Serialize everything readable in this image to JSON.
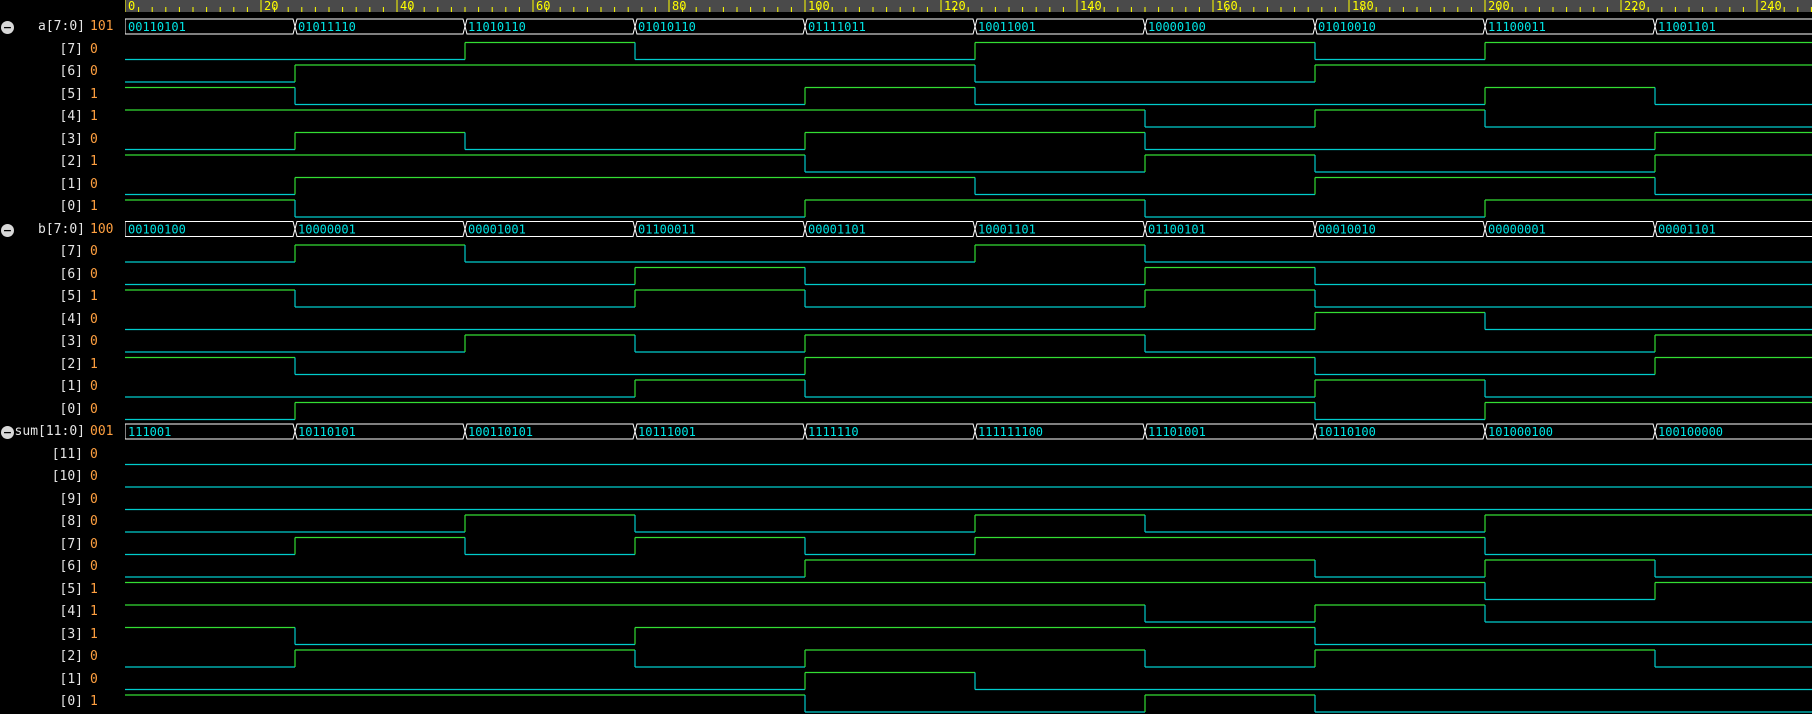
{
  "ruler": {
    "ticks": [
      "0",
      "20",
      "40",
      "60",
      "80",
      "100",
      "120",
      "140",
      "160",
      "180",
      "200",
      "220",
      "240"
    ],
    "color": "#ffff00"
  },
  "colors": {
    "background": "#000000",
    "high": "#33dd33",
    "low": "#00cccc",
    "bus_outline": "#ffffff",
    "bus_text": "#00e5e5",
    "value_text": "#ffa040",
    "name_text": "#e6e6e6"
  },
  "collapse_icon": "minus-circle-icon",
  "time": {
    "start": 0,
    "end": 248,
    "segment_starts": [
      0,
      25,
      50,
      75,
      100,
      125,
      150,
      175,
      200,
      225
    ]
  },
  "groups": [
    {
      "name": "a[7:0]",
      "value": "101",
      "bus_values": [
        "00110101",
        "01011110",
        "11010110",
        "01010110",
        "01111011",
        "10011001",
        "10000100",
        "01010010",
        "11100011",
        "11001101"
      ],
      "bits": [
        {
          "name": "[7]",
          "value": "0",
          "levels": [
            0,
            0,
            1,
            0,
            0,
            1,
            1,
            0,
            1,
            1
          ]
        },
        {
          "name": "[6]",
          "value": "0",
          "levels": [
            0,
            1,
            1,
            1,
            1,
            0,
            0,
            1,
            1,
            1
          ]
        },
        {
          "name": "[5]",
          "value": "1",
          "levels": [
            1,
            0,
            0,
            0,
            1,
            0,
            0,
            0,
            1,
            0
          ]
        },
        {
          "name": "[4]",
          "value": "1",
          "levels": [
            1,
            1,
            1,
            1,
            1,
            1,
            0,
            1,
            0,
            0
          ]
        },
        {
          "name": "[3]",
          "value": "0",
          "levels": [
            0,
            1,
            0,
            0,
            1,
            1,
            0,
            0,
            0,
            1
          ]
        },
        {
          "name": "[2]",
          "value": "1",
          "levels": [
            1,
            1,
            1,
            1,
            0,
            0,
            1,
            0,
            0,
            1
          ]
        },
        {
          "name": "[1]",
          "value": "0",
          "levels": [
            0,
            1,
            1,
            1,
            1,
            0,
            0,
            1,
            1,
            0
          ]
        },
        {
          "name": "[0]",
          "value": "1",
          "levels": [
            1,
            0,
            0,
            0,
            1,
            1,
            0,
            0,
            1,
            1
          ]
        }
      ]
    },
    {
      "name": "b[7:0]",
      "value": "100",
      "bus_values": [
        "00100100",
        "10000001",
        "00001001",
        "01100011",
        "00001101",
        "10001101",
        "01100101",
        "00010010",
        "00000001",
        "00001101"
      ],
      "bits": [
        {
          "name": "[7]",
          "value": "0",
          "levels": [
            0,
            1,
            0,
            0,
            0,
            1,
            0,
            0,
            0,
            0
          ]
        },
        {
          "name": "[6]",
          "value": "0",
          "levels": [
            0,
            0,
            0,
            1,
            0,
            0,
            1,
            0,
            0,
            0
          ]
        },
        {
          "name": "[5]",
          "value": "1",
          "levels": [
            1,
            0,
            0,
            1,
            0,
            0,
            1,
            0,
            0,
            0
          ]
        },
        {
          "name": "[4]",
          "value": "0",
          "levels": [
            0,
            0,
            0,
            0,
            0,
            0,
            0,
            1,
            0,
            0
          ]
        },
        {
          "name": "[3]",
          "value": "0",
          "levels": [
            0,
            0,
            1,
            0,
            1,
            1,
            0,
            0,
            0,
            1
          ]
        },
        {
          "name": "[2]",
          "value": "1",
          "levels": [
            1,
            0,
            0,
            0,
            1,
            1,
            1,
            0,
            0,
            1
          ]
        },
        {
          "name": "[1]",
          "value": "0",
          "levels": [
            0,
            0,
            0,
            1,
            0,
            0,
            0,
            1,
            0,
            0
          ]
        },
        {
          "name": "[0]",
          "value": "0",
          "levels": [
            0,
            1,
            1,
            1,
            1,
            1,
            1,
            0,
            1,
            1
          ]
        }
      ]
    },
    {
      "name": "sum[11:0]",
      "value": "001",
      "bus_values": [
        "111001",
        "10110101",
        "100110101",
        "10111001",
        "1111110",
        "111111100",
        "11101001",
        "10110100",
        "101000100",
        "100100000"
      ],
      "bits": [
        {
          "name": "[11]",
          "value": "0",
          "levels": [
            0,
            0,
            0,
            0,
            0,
            0,
            0,
            0,
            0,
            0
          ]
        },
        {
          "name": "[10]",
          "value": "0",
          "levels": [
            0,
            0,
            0,
            0,
            0,
            0,
            0,
            0,
            0,
            0
          ]
        },
        {
          "name": "[9]",
          "value": "0",
          "levels": [
            0,
            0,
            0,
            0,
            0,
            0,
            0,
            0,
            0,
            0
          ]
        },
        {
          "name": "[8]",
          "value": "0",
          "levels": [
            0,
            0,
            1,
            0,
            0,
            1,
            0,
            0,
            1,
            1
          ]
        },
        {
          "name": "[7]",
          "value": "0",
          "levels": [
            0,
            1,
            0,
            1,
            0,
            1,
            1,
            1,
            0,
            0
          ]
        },
        {
          "name": "[6]",
          "value": "0",
          "levels": [
            0,
            0,
            0,
            0,
            1,
            1,
            1,
            0,
            1,
            0
          ]
        },
        {
          "name": "[5]",
          "value": "1",
          "levels": [
            1,
            1,
            1,
            1,
            1,
            1,
            1,
            1,
            0,
            1
          ]
        },
        {
          "name": "[4]",
          "value": "1",
          "levels": [
            1,
            1,
            1,
            1,
            1,
            1,
            0,
            1,
            0,
            0
          ]
        },
        {
          "name": "[3]",
          "value": "1",
          "levels": [
            1,
            0,
            0,
            1,
            1,
            1,
            1,
            0,
            0,
            0
          ]
        },
        {
          "name": "[2]",
          "value": "0",
          "levels": [
            0,
            1,
            1,
            0,
            1,
            1,
            0,
            1,
            1,
            0
          ]
        },
        {
          "name": "[1]",
          "value": "0",
          "levels": [
            0,
            0,
            0,
            0,
            1,
            0,
            0,
            0,
            0,
            0
          ]
        },
        {
          "name": "[0]",
          "value": "1",
          "levels": [
            1,
            1,
            1,
            1,
            0,
            0,
            1,
            0,
            0,
            0
          ]
        }
      ]
    }
  ]
}
